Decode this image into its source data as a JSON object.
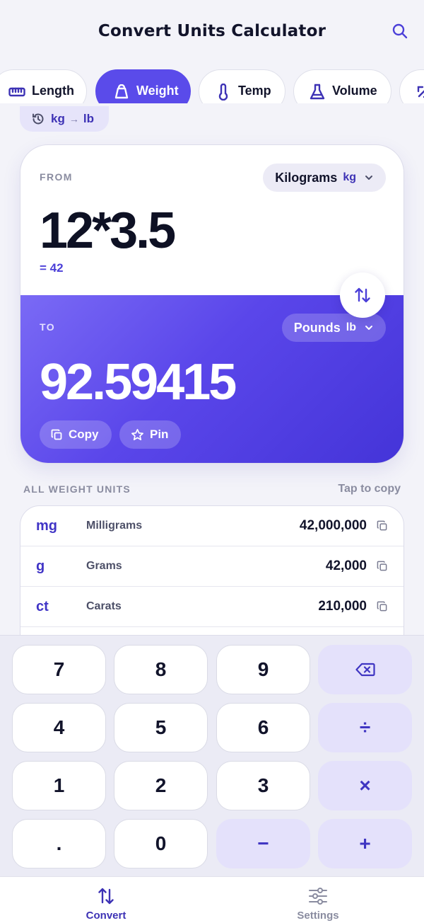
{
  "header": {
    "title": "Convert Units Calculator",
    "search_icon": "search-icon"
  },
  "categories": [
    {
      "label": "Length",
      "icon": "ruler-icon",
      "active": false
    },
    {
      "label": "Weight",
      "icon": "weight-icon",
      "active": true
    },
    {
      "label": "Temp",
      "icon": "thermometer-icon",
      "active": false
    },
    {
      "label": "Volume",
      "icon": "flask-icon",
      "active": false
    },
    {
      "label": "",
      "icon": "area-icon",
      "active": false
    }
  ],
  "recent": {
    "from": "kg",
    "arrow": "→",
    "to": "lb",
    "icon": "history-icon"
  },
  "converter": {
    "from_label": "FROM",
    "from_unit_name": "Kilograms",
    "from_unit_abbr": "kg",
    "expression": "12*3.5",
    "evaluated": "= 42",
    "to_label": "TO",
    "to_unit_name": "Pounds",
    "to_unit_abbr": "lb",
    "result": "92.59415",
    "copy_label": "Copy",
    "pin_label": "Pin"
  },
  "all_units": {
    "heading": "ALL WEIGHT UNITS",
    "hint": "Tap to copy",
    "rows": [
      {
        "symbol": "mg",
        "name": "Milligrams",
        "value": "42,000,000"
      },
      {
        "symbol": "g",
        "name": "Grams",
        "value": "42,000"
      },
      {
        "symbol": "ct",
        "name": "Carats",
        "value": "210,000"
      }
    ]
  },
  "keypad": {
    "keys": [
      "7",
      "8",
      "9",
      "⌫",
      "4",
      "5",
      "6",
      "÷",
      "1",
      "2",
      "3",
      "×",
      ".",
      "0",
      "−",
      "+"
    ]
  },
  "nav": {
    "convert_label": "Convert",
    "settings_label": "Settings"
  },
  "colors": {
    "accent": "#5a4bea",
    "accent_dark": "#3d32b5",
    "operator_bg": "#e4e1fb",
    "background": "#f3f3f9"
  }
}
